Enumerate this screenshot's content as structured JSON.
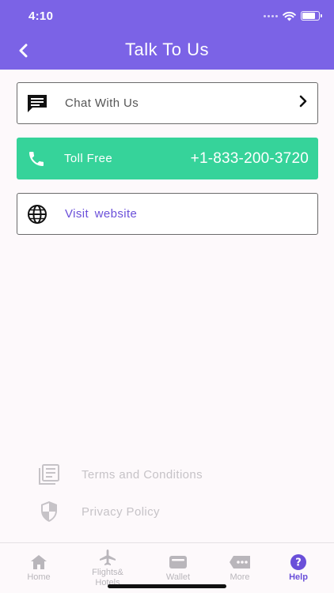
{
  "status_bar": {
    "time": "4:10",
    "battery_level": 0.8
  },
  "header": {
    "title": "Talk To Us"
  },
  "actions": {
    "chat": {
      "label": "Chat With Us"
    },
    "toll_free": {
      "label": "Toll Free",
      "phone": "+1-833-200-3720"
    },
    "website": {
      "label": "Visit  website"
    }
  },
  "footer_links": {
    "terms": "Terms and Conditions",
    "privacy": "Privacy Policy"
  },
  "tabbar": {
    "tabs": [
      {
        "label": "Home",
        "icon": "home-icon"
      },
      {
        "label": "Flights& Hotels",
        "icon": "airplane-icon"
      },
      {
        "label": "Wallet",
        "icon": "wallet-icon"
      },
      {
        "label": "More",
        "icon": "more-icon"
      },
      {
        "label": "Help",
        "icon": "help-icon"
      }
    ],
    "active": "Help"
  },
  "colors": {
    "header": "#7b63e6",
    "toll_free_bg": "#36d39a",
    "accent": "#6a4fd9",
    "muted": "#c6c3c7"
  }
}
